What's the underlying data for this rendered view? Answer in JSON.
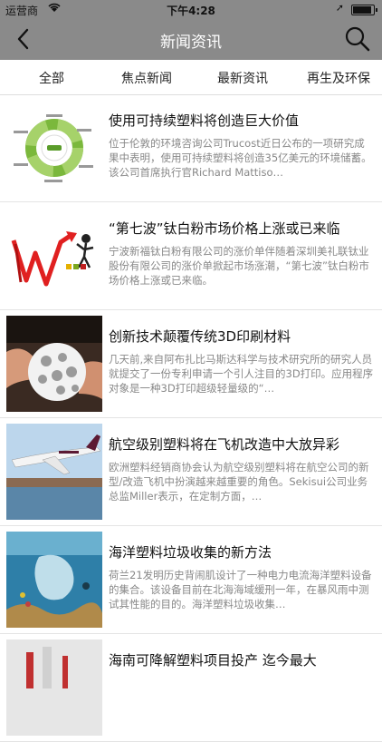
{
  "statusbar": {
    "carrier": "运营商",
    "time": "下午4:28"
  },
  "navbar": {
    "title": "新闻资讯"
  },
  "tabs": [
    "全部",
    "焦点新闻",
    "最新资讯",
    "再生及环保"
  ],
  "items": [
    {
      "title": "使用可持续塑料将创造巨大价值",
      "desc": "位于伦敦的环境咨询公司Trucost近日公布的一项研究成果中表明，使用可持续塑料将创造35亿美元的环境储蓄。该公司首席执行官Richard Mattiso…"
    },
    {
      "title": "“第七波”钛白粉市场价格上涨或已来临",
      "desc": "宁波新福钛白粉有限公司的涨价单伴随着深圳美礼联钛业股份有限公司的涨价单掀起市场涨潮，“第七波”钛白粉市场价格上涨或已来临。"
    },
    {
      "title": "创新技术颠覆传统3D印刷材料",
      "desc": "几天前,来自阿布扎比马斯达科学与技术研究所的研究人员就提交了一份专利申请一个引人注目的3D打印。应用程序对象是一种3D打印超级轻量级的“…"
    },
    {
      "title": "航空级别塑料将在飞机改造中大放异彩",
      "desc": "欧洲塑料经销商协会认为航空级别塑料将在航空公司的新型/改造飞机中扮演越来越重要的角色。Sekisui公司业务总监Miller表示，在定制方面，…"
    },
    {
      "title": "海洋塑料垃圾收集的新方法",
      "desc": "荷兰21发明历史背闹肌设计了一种电力电流海洋塑料设备的集合。该设备目前在北海海域缓刑一年，在暴风雨中测试其性能的目的。海洋塑料垃圾收集…"
    },
    {
      "title": "海南可降解塑料项目投产 迄今最大",
      "desc": ""
    }
  ],
  "icons": {
    "back": "chevron-left-icon",
    "search": "search-icon"
  }
}
